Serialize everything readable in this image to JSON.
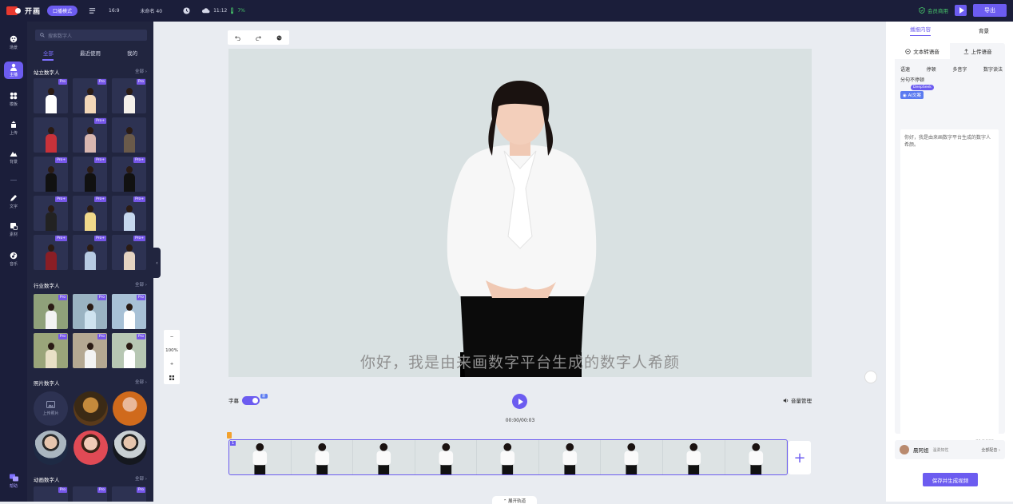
{
  "topbar": {
    "app_name": "开画",
    "mode_pill": "口播模式",
    "ratio": "16:9",
    "doc_name": "未命名 40",
    "time": "11:12",
    "progress_text": "7%",
    "vip_label": "会员商用",
    "export_label": "导出"
  },
  "rail": {
    "items": [
      {
        "label": "场景"
      },
      {
        "label": "主播"
      },
      {
        "label": "模板"
      },
      {
        "label": "上传"
      },
      {
        "label": "背景"
      },
      {
        "label": "文字"
      },
      {
        "label": "素材"
      },
      {
        "label": "音乐"
      },
      {
        "label": "帮助"
      }
    ]
  },
  "panel": {
    "search_placeholder": "搜索数字人",
    "tabs": [
      "全部",
      "最近使用",
      "我的"
    ],
    "sections": {
      "standing": {
        "title": "站立数字人",
        "more": "全部"
      },
      "industry": {
        "title": "行业数字人",
        "more": "全部"
      },
      "photo": {
        "title": "照片数字人",
        "more": "全部"
      },
      "animated": {
        "title": "动画数字人",
        "more": "全部"
      }
    },
    "tag_pro": "Pro",
    "tag_pro_plus": "Pro+",
    "upload_photo": "上传照片"
  },
  "canvas": {
    "subtitle": "你好，我是由来画数字平台生成的数字人希颜",
    "zoom_level": "100%",
    "caption_label": "字幕",
    "caption_badge": "新",
    "time_display": "00:00/00:03",
    "volume_label": "音量管理",
    "expand_label": "展开轨道",
    "segment_number": "1"
  },
  "right": {
    "tabs": [
      "播报内容",
      "背景"
    ],
    "subtabs": [
      "文本转语音",
      "上传语音"
    ],
    "chips": [
      "语速",
      "停顿",
      "多音字",
      "数字读法"
    ],
    "pause_label": "分句不停顿",
    "deepseek_badge": "DeepSeek",
    "ai_button": "AI文案",
    "script_text": "你好，我是由来画数字平台生成的数字人希颜。",
    "char_count": "21/1000",
    "voice_name": "晨阿姐",
    "voice_desc": "温柔知性",
    "voice_more": "全部配音",
    "save_label": "保存并生成视频"
  },
  "colors": {
    "accent": "#6c5cf0",
    "vip": "#47c66a",
    "dark_bg": "#1b1e3a"
  }
}
